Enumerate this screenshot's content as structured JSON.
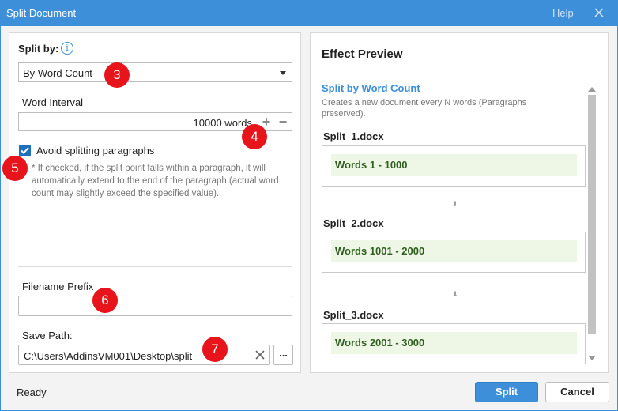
{
  "window": {
    "title": "Split Document",
    "help_label": "Help",
    "close_icon": "close-icon"
  },
  "left": {
    "split_by_label": "Split by:",
    "info_icon": "info-icon",
    "info_glyph": "i",
    "split_by_value": "By Word Count",
    "word_interval_label": "Word Interval",
    "word_interval_value": "10000 words",
    "plus_glyph": "+",
    "minus_glyph": "−",
    "avoid_checkbox_checked": true,
    "avoid_label": "Avoid splitting paragraphs",
    "avoid_note": "* If checked, if the split point falls within a paragraph, it will automatically extend to the end of the paragraph (actual word count may slightly exceed the specified value).",
    "filename_prefix_label": "Filename Prefix",
    "filename_prefix_value": "",
    "save_path_label": "Save Path:",
    "save_path_value": "C:\\Users\\AddinsVM001\\Desktop\\split",
    "browse_label": "..."
  },
  "preview": {
    "title": "Effect Preview",
    "subtitle": "Split by Word Count",
    "description": "Creates a new document every N words (Paragraphs preserved).",
    "arrow_glyph": "⬇",
    "files": [
      {
        "name": "Split_1.docx",
        "range": "Words 1 - 1000"
      },
      {
        "name": "Split_2.docx",
        "range": "Words 1001 - 2000"
      },
      {
        "name": "Split_3.docx",
        "range": "Words 2001 - 3000"
      }
    ]
  },
  "badges": [
    "3",
    "4",
    "5",
    "6",
    "7"
  ],
  "footer": {
    "status": "Ready",
    "split_label": "Split",
    "cancel_label": "Cancel"
  },
  "colors": {
    "accent": "#3c8fd8",
    "badge": "#e8141b",
    "range_bg": "#eef7e6",
    "range_text": "#2f5e1f"
  }
}
